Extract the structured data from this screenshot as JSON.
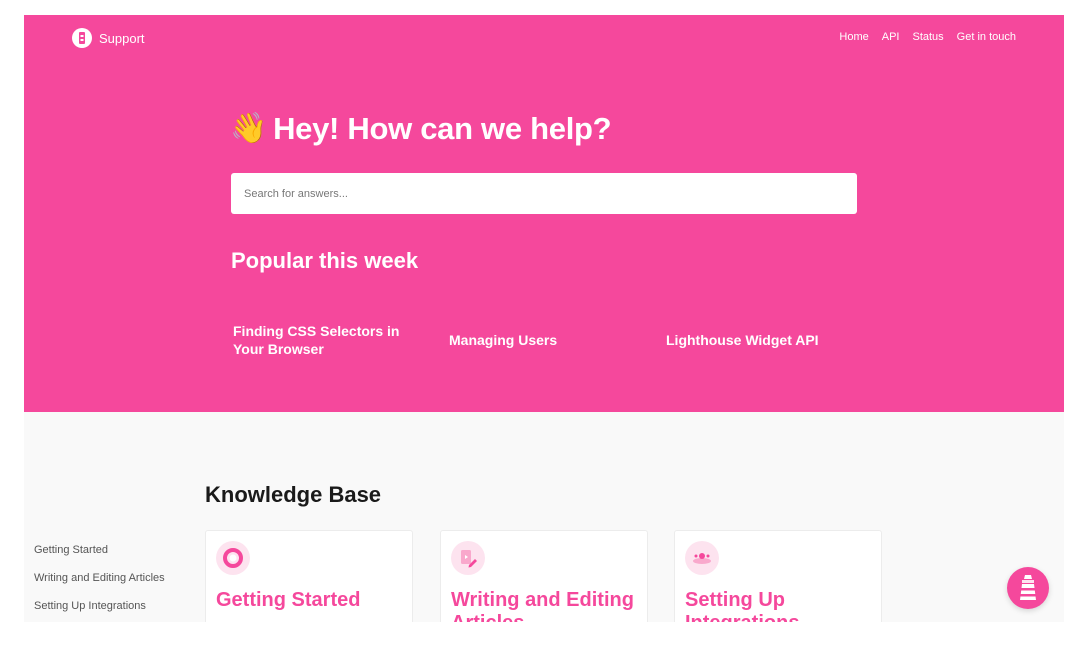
{
  "header": {
    "brand": "Support",
    "nav": [
      "Home",
      "API",
      "Status",
      "Get in touch"
    ]
  },
  "hero": {
    "emoji": "👋",
    "title": "Hey! How can we help?",
    "search": {
      "placeholder": "Search for answers...",
      "value": ""
    },
    "popular_title": "Popular this week",
    "popular": [
      "Finding CSS Selectors in Your Browser",
      "Managing Users",
      "Lighthouse Widget API"
    ]
  },
  "kb": {
    "title": "Knowledge Base",
    "sidebar": [
      "Getting Started",
      "Writing and Editing Articles",
      "Setting Up Integrations"
    ],
    "cards": [
      {
        "title": "Getting Started",
        "icon": "lifebuoy-icon"
      },
      {
        "title": "Writing and Editing Articles",
        "icon": "edit-document-icon"
      },
      {
        "title": "Setting Up Integrations",
        "icon": "integrations-icon"
      }
    ]
  },
  "colors": {
    "brand": "#f5489c",
    "background": "#f9f9f9",
    "card_icon_bg": "#fde3ef"
  }
}
